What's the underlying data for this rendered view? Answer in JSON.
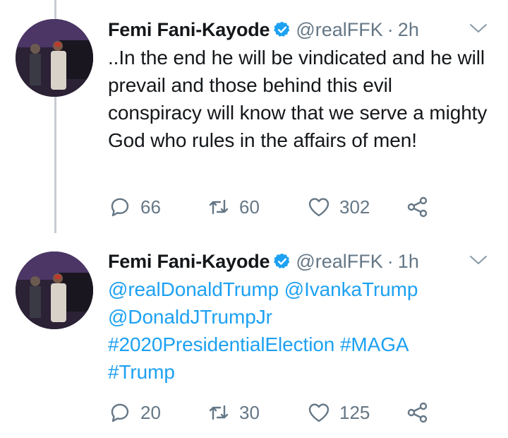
{
  "tweets": [
    {
      "name": "Femi Fani-Kayode",
      "handle": "@realFFK",
      "dot": "·",
      "time": "2h",
      "text": "..In the end he will be vindicated and he will prevail and those behind this evil conspiracy will know that we serve a mighty God who rules in the affairs of men!",
      "replies": "66",
      "retweets": "60",
      "likes": "302"
    },
    {
      "name": "Femi Fani-Kayode",
      "handle": "@realFFK",
      "dot": "·",
      "time": "1h",
      "lines": [
        "@realDonaldTrump @IvankaTrump",
        "@DonaldJTrumpJr",
        "#2020PresidentialElection #MAGA",
        "#Trump"
      ],
      "replies": "20",
      "retweets": "30",
      "likes": "125"
    }
  ],
  "colors": {
    "link": "#1da1f2",
    "secondary": "#657786",
    "verified": "#1da1f2",
    "thread_line": "#c7cdd2"
  },
  "icons": [
    "verified-badge-icon",
    "chevron-down-icon",
    "reply-icon",
    "retweet-icon",
    "like-icon",
    "share-icon"
  ]
}
